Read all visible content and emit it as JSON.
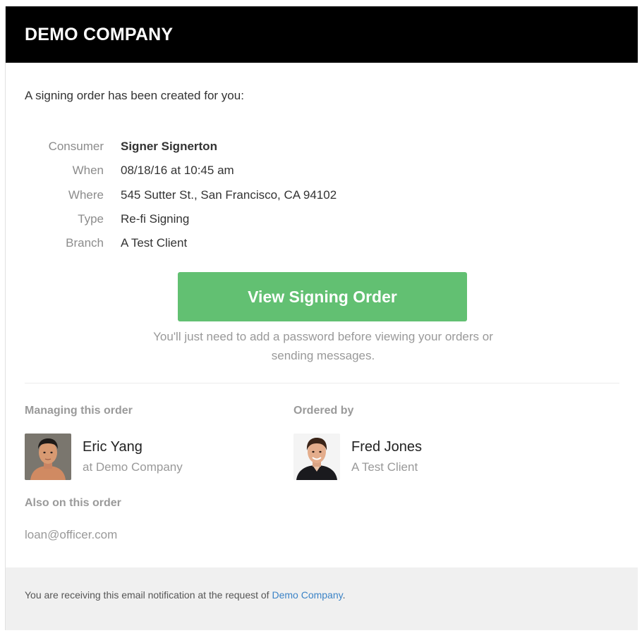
{
  "header": {
    "company_name": "DEMO COMPANY"
  },
  "intro": "A signing order has been created for you:",
  "details": [
    {
      "label": "Consumer",
      "value": "Signer Signerton"
    },
    {
      "label": "When",
      "value": "08/18/16 at 10:45 am"
    },
    {
      "label": "Where",
      "value": "545 Sutter St., San Francisco, CA 94102"
    },
    {
      "label": "Type",
      "value": "Re-fi Signing"
    },
    {
      "label": "Branch",
      "value": "A Test Client"
    }
  ],
  "cta": {
    "label": "View Signing Order",
    "color": "#62c072"
  },
  "note": "You'll just need to add a password before viewing your orders or sending messages.",
  "managing": {
    "heading": "Managing this order",
    "name": "Eric Yang",
    "subtitle": "at Demo Company",
    "avatar_icon": "person-photo"
  },
  "ordered_by": {
    "heading": "Ordered by",
    "name": "Fred Jones",
    "subtitle": "A Test Client",
    "avatar_icon": "person-photo"
  },
  "also_on_order": {
    "heading": "Also on this order",
    "email": "loan@officer.com"
  },
  "footer": {
    "prefix": "You are receiving this email notification at the request of ",
    "link": "Demo Company",
    "suffix": ".",
    "link_color": "#3b83c6"
  }
}
